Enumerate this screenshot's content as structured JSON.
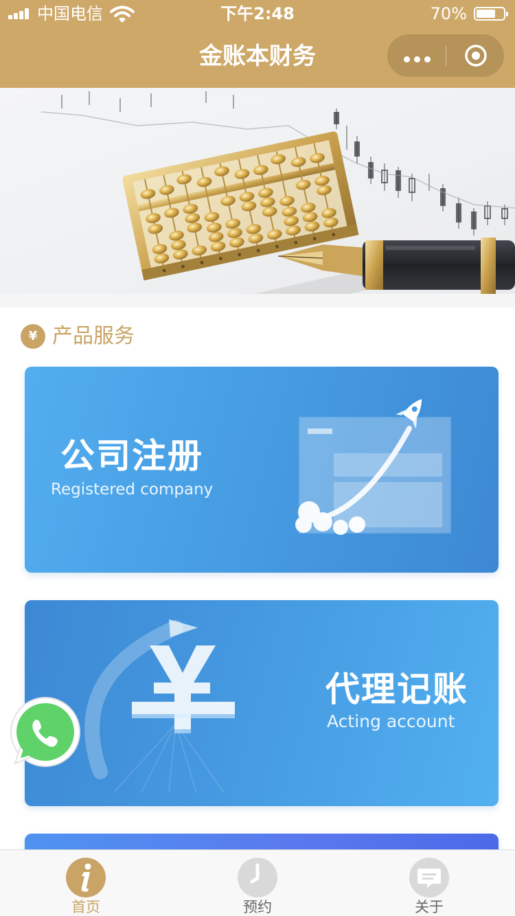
{
  "status_bar": {
    "carrier": "中国电信",
    "time": "下午2:48",
    "battery_percent": "70%",
    "battery_level": 0.7,
    "icons": [
      "signal-icon",
      "wifi-icon",
      "battery-icon"
    ]
  },
  "nav": {
    "title": "金账本财务",
    "capsule_icons": [
      "more-dots-icon",
      "close-target-icon"
    ]
  },
  "banner": {
    "description_icon": "abacus-and-pen-image"
  },
  "section": {
    "icon_glyph": "¥",
    "title": "产品服务"
  },
  "cards": [
    {
      "title": "公司注册",
      "subtitle": "Registered company",
      "icon": "rocket-icon"
    },
    {
      "title": "代理记账",
      "subtitle": "Acting account",
      "icon": "yuan-icon"
    }
  ],
  "floating": {
    "icon": "whatsapp-icon"
  },
  "tabbar": {
    "items": [
      {
        "label": "首页",
        "icon": "info-icon",
        "active": true
      },
      {
        "label": "预约",
        "icon": "clock-icon",
        "active": false
      },
      {
        "label": "关于",
        "icon": "chat-icon",
        "active": false
      }
    ]
  },
  "colors": {
    "brand": "#cda868",
    "accent_text": "#c9a466",
    "card_blue": "#4599e0"
  }
}
